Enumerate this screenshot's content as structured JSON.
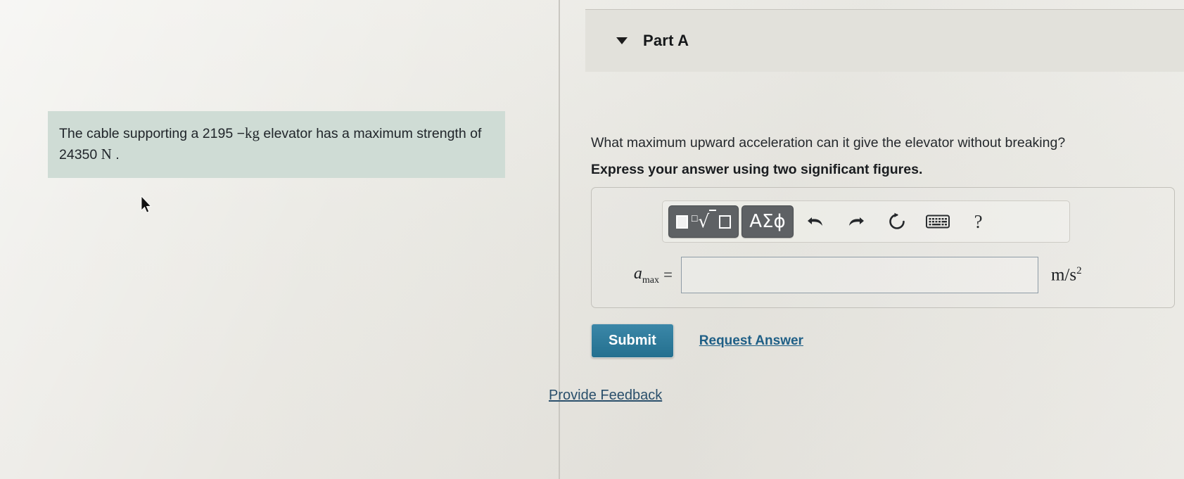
{
  "problem": {
    "text_before_unit1": "The cable supporting a 2195 −",
    "unit1": "kg",
    "text_middle": " elevator has a maximum strength of 24350 ",
    "unit2": "N",
    "text_after": " ."
  },
  "part": {
    "caret_icon": "chevron-down-icon",
    "title": "Part A",
    "question": "What maximum upward acceleration can it give the elevator without breaking?",
    "instruction": "Express your answer using two significant figures."
  },
  "math_toolbar": {
    "template_button_label": "■√□",
    "greek_button_label": "ΑΣϕ",
    "undo_icon": "undo-arrow-icon",
    "redo_icon": "redo-arrow-icon",
    "reset_icon": "reset-circular-arrow-icon",
    "keyboard_icon": "keyboard-icon",
    "help_label": "?"
  },
  "answer": {
    "variable": "a",
    "subscript": "max",
    "equals": "=",
    "value": "",
    "placeholder": "",
    "units": "m/s",
    "units_exponent": "2"
  },
  "actions": {
    "submit_label": "Submit",
    "request_answer_label": "Request Answer",
    "feedback_label": "Provide Feedback"
  },
  "colors": {
    "problem_highlight": "#cfdcd5",
    "submit_button": "#2d7a9c",
    "link": "#1f5f86",
    "page_background": "#e9e8e3"
  }
}
